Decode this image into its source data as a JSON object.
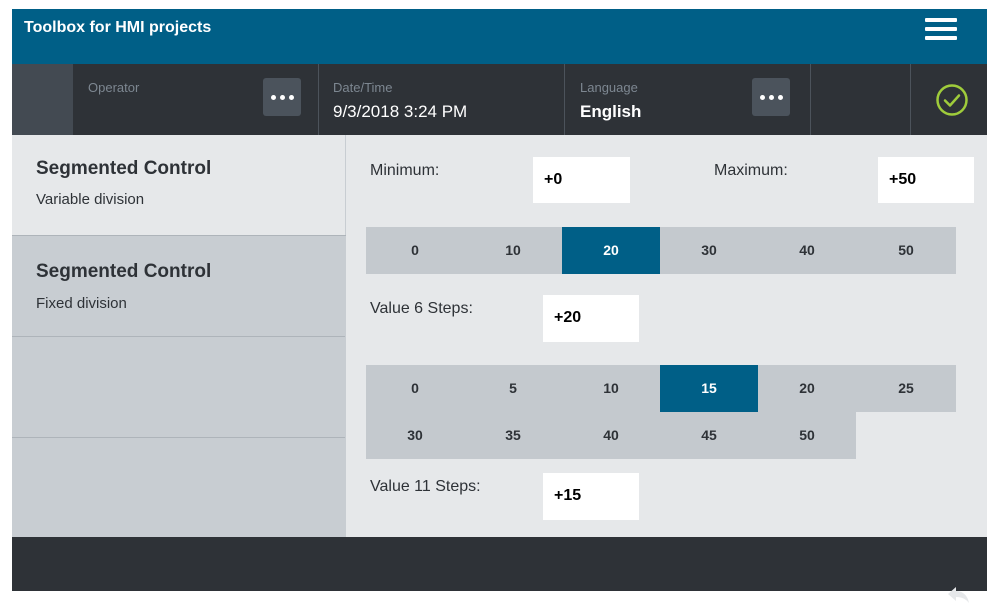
{
  "app": {
    "title": "Toolbox for HMI projects"
  },
  "status": {
    "operator_label": "Operator",
    "datetime_label": "Date/Time",
    "datetime_value": "9/3/2018 3:24 PM",
    "language_label": "Language",
    "language_value": "English"
  },
  "sidebar": {
    "items": [
      {
        "title": "Segmented Control",
        "subtitle": "Variable division",
        "selected": true
      },
      {
        "title": "Segmented Control",
        "subtitle": "Fixed division",
        "selected": false
      },
      {
        "title": "",
        "subtitle": "",
        "selected": false
      },
      {
        "title": "",
        "subtitle": "",
        "selected": false
      }
    ]
  },
  "main": {
    "minimum_label": "Minimum:",
    "minimum_value": "+0",
    "maximum_label": "Maximum:",
    "maximum_value": "+50",
    "seg6": {
      "options": [
        "0",
        "10",
        "20",
        "30",
        "40",
        "50"
      ],
      "selected": "20"
    },
    "value6_label": "Value 6 Steps:",
    "value6_value": "+20",
    "seg11": {
      "options": [
        "0",
        "5",
        "10",
        "15",
        "20",
        "25",
        "30",
        "35",
        "40",
        "45",
        "50"
      ],
      "selected": "15"
    },
    "value11_label": "Value 11 Steps:",
    "value11_value": "+15"
  },
  "icons": {
    "menu": "hamburger-menu-icon",
    "more": "ellipsis-icon",
    "status_ok": "check-circle-icon",
    "back": "back-arrow-icon"
  },
  "colors": {
    "accent": "#005f87",
    "status_bar": "#2e3237",
    "ok_green": "#9fcc3b"
  }
}
